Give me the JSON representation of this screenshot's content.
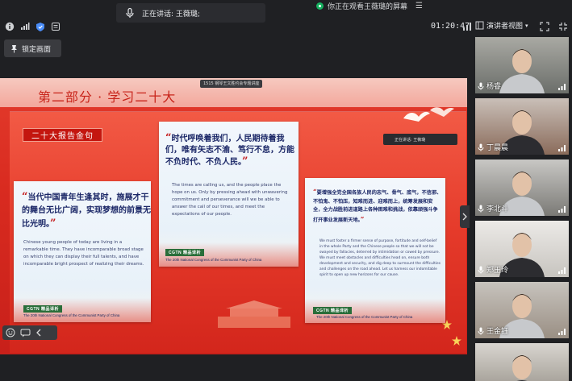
{
  "speaking": {
    "text": "正在讲话: 王薇璐;"
  },
  "watching": {
    "text": "你正在观看王薇璐的屏幕"
  },
  "toolbar": {
    "timer": "01:20:47",
    "view_label": "演讲者视图"
  },
  "lock_button": {
    "label": "锁定画面"
  },
  "slide": {
    "section_title": "第二部分 · 学习二十大",
    "host_tag": "1515 钢琴王文胜约会专题讲座",
    "label": "二十大报告金句",
    "presenter_tag": "正在讲话: 王薇璐",
    "cards": [
      {
        "quote": "当代中国青年生逢其时，施展才干的舞台无比广阔，实现梦想的前景无比光明。",
        "english": "Chinese young people of today are living in a remarkable time. They have incomparable broad stage on which they can display their full talents, and have incomparable bright prospect of realizing their dreams.",
        "badge": "CGTN 精品译析",
        "congress": "The 20th National Congress of the Communist Party of China"
      },
      {
        "quote": "时代呼唤着我们，人民期待着我们，唯有矢志不渝、笃行不怠，方能不负时代、不负人民。",
        "english": "The times are calling us, and the people place the hope on us. Only by pressing ahead with unwavering commitment and perseverance will we be able to answer the call of our times, and meet the expectations of our people.",
        "badge": "CGTN 精品译析",
        "congress": "The 20th National Congress of the Communist Party of China"
      },
      {
        "quote": "要增强全党全国各族人民的志气、骨气、底气，不信邪、不怕鬼、不怕压，知难而进、迎难而上，统筹发展和安全，全力战胜前进道路上各种困难和挑战，依靠顽强斗争打开事业发展新天地。",
        "english": "We must foster a firmer sense of purpose, fortitude and self-belief in the whole Party and the Chinese people so that we will not be swayed by fallacies, deterred by intimidation or cowed by pressure. We must meet obstacles and difficulties head on, ensure both development and security, and dig deep to surmount the difficulties and challenges on the road ahead. Let us harness our indomitable spirit to open up new horizons for our cause.",
        "badge": "CGTN 精品译析",
        "congress": "The 20th National Congress of the Communist Party of China"
      }
    ]
  },
  "participants": [
    {
      "name": "杨睿",
      "colors": [
        "#a9a9a3",
        "#6b6e6a"
      ]
    },
    {
      "name": "丁晨晨",
      "colors": [
        "#c9bfb8",
        "#8a6b5a"
      ]
    },
    {
      "name": "李北斗",
      "colors": [
        "#c8c7c4",
        "#7b7a76"
      ]
    },
    {
      "name": "郑玉玲",
      "colors": [
        "#eceae7",
        "#c7c4bf"
      ]
    },
    {
      "name": "王金钰",
      "colors": [
        "#c7c3bd",
        "#9a8f84"
      ]
    },
    {
      "name": "",
      "colors": [
        "#d8d5d0",
        "#aaa59d"
      ]
    }
  ],
  "colors": {
    "accent_red": "#d92b20",
    "card_navy": "#1b2767",
    "mic_green": "#16b05f"
  }
}
